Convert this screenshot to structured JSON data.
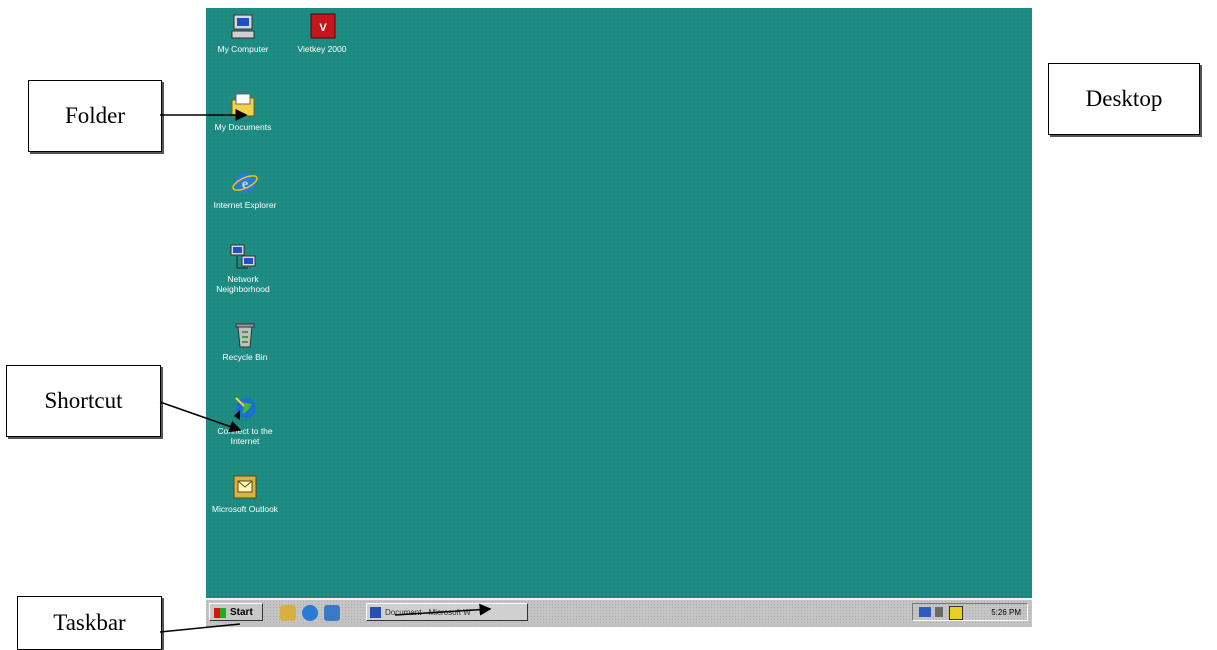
{
  "callouts": {
    "folder": "Folder",
    "desktop": "Desktop",
    "shortcut": "Shortcut",
    "taskbar": "Taskbar"
  },
  "desktop_icons": [
    {
      "key": "my-computer",
      "label": "My Computer"
    },
    {
      "key": "vietkey",
      "label": "Vietkey 2000"
    },
    {
      "key": "my-documents",
      "label": "My Documents"
    },
    {
      "key": "internet-explorer",
      "label": "Internet Explorer"
    },
    {
      "key": "network-neighborhood",
      "label": "Network Neighborhood"
    },
    {
      "key": "recycle-bin",
      "label": "Recycle Bin"
    },
    {
      "key": "connect-internet",
      "label": "Connect to the Internet"
    },
    {
      "key": "outlook",
      "label": "Microsoft Outlook"
    }
  ],
  "taskbar": {
    "start_label": "Start",
    "task_label": "Document - Microsoft W",
    "clock": "5:26 PM"
  },
  "colors": {
    "desktop": "#1c8a80",
    "taskbar": "#c4c4c4"
  }
}
